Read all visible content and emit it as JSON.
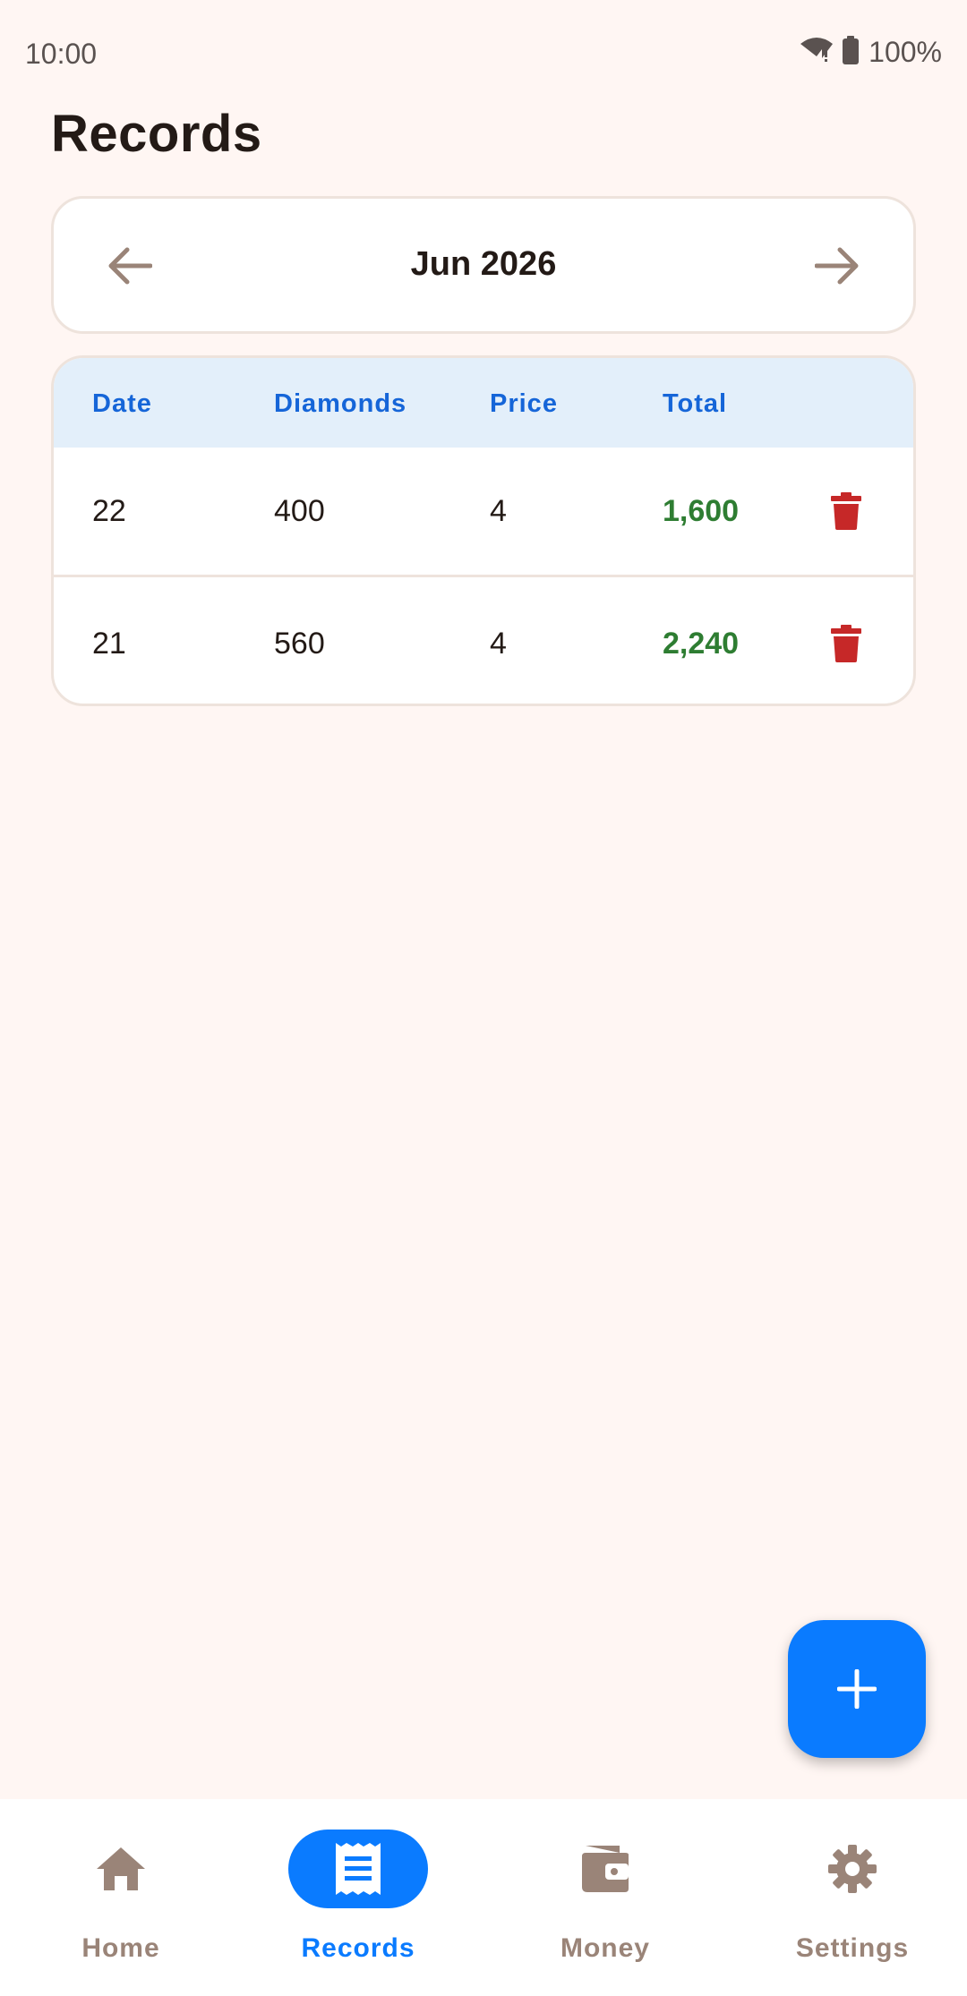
{
  "status_bar": {
    "time": "10:00",
    "battery": "100%"
  },
  "page": {
    "title": "Records"
  },
  "month_nav": {
    "label": "Jun 2026"
  },
  "table": {
    "headers": {
      "date": "Date",
      "diamonds": "Diamonds",
      "price": "Price",
      "total": "Total"
    },
    "rows": [
      {
        "date": "22",
        "diamonds": "400",
        "price": "4",
        "total": "1,600"
      },
      {
        "date": "21",
        "diamonds": "560",
        "price": "4",
        "total": "2,240"
      }
    ]
  },
  "bottom_nav": {
    "items": [
      {
        "label": "Home",
        "icon": "home-icon"
      },
      {
        "label": "Records",
        "icon": "receipt-icon",
        "active": true
      },
      {
        "label": "Money",
        "icon": "wallet-icon"
      },
      {
        "label": "Settings",
        "icon": "gear-icon"
      }
    ]
  },
  "colors": {
    "accent": "#0A7BFF",
    "header_text": "#1565D8",
    "total_text": "#2E7D32",
    "delete_icon": "#C62828",
    "background": "#FFF6F3"
  }
}
